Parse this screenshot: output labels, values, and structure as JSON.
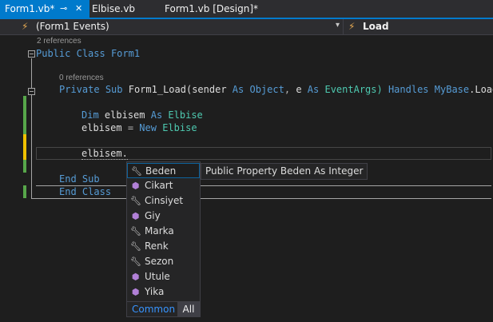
{
  "tabs": [
    {
      "label": "Form1.vb*",
      "active": true
    },
    {
      "label": "Elbise.vb",
      "active": false
    },
    {
      "label": "Form1.vb [Design]*",
      "active": false
    }
  ],
  "tab_icons": {
    "pin": "⊸",
    "close": "✕"
  },
  "nav": {
    "left": "(Form1 Events)",
    "right": "Load",
    "icon": "lightning-icon"
  },
  "code": {
    "lens_class": "2 references",
    "lens_sub": "0 references",
    "line_class": {
      "kw1": "Public",
      "kw2": "Class",
      "name": "Form1"
    },
    "line_sub": {
      "kw1": "Private",
      "kw2": "Sub",
      "name": "Form1_Load(sender",
      "as1": "As",
      "type1": "Object",
      "sep": ",",
      "param2": "e",
      "as2": "As",
      "type2": "EventArgs)",
      "handles": "Handles",
      "mybase": "MyBase",
      "event": ".Load"
    },
    "line_dim": {
      "kw": "Dim",
      "name": "elbisem",
      "as": "As",
      "type": "Elbise"
    },
    "line_assign": {
      "name": "elbisem",
      "eq": "=",
      "kw": "New",
      "type": "Elbise"
    },
    "line_typing": "elbisem.",
    "line_endsub": {
      "kw1": "End",
      "kw2": "Sub"
    },
    "line_endclass": {
      "kw1": "End",
      "kw2": "Class"
    }
  },
  "completion": {
    "items": [
      {
        "label": "Beden",
        "kind": "property",
        "icon": "wrench-icon",
        "selected": true
      },
      {
        "label": "Cikart",
        "kind": "method",
        "icon": "cube-icon",
        "selected": false
      },
      {
        "label": "Cinsiyet",
        "kind": "property",
        "icon": "wrench-icon",
        "selected": false
      },
      {
        "label": "Giy",
        "kind": "method",
        "icon": "cube-icon",
        "selected": false
      },
      {
        "label": "Marka",
        "kind": "property",
        "icon": "wrench-icon",
        "selected": false
      },
      {
        "label": "Renk",
        "kind": "property",
        "icon": "wrench-icon",
        "selected": false
      },
      {
        "label": "Sezon",
        "kind": "property",
        "icon": "wrench-icon",
        "selected": false
      },
      {
        "label": "Utule",
        "kind": "method",
        "icon": "cube-icon",
        "selected": false
      },
      {
        "label": "Yika",
        "kind": "method",
        "icon": "cube-icon",
        "selected": false
      }
    ],
    "filters": {
      "common": "Common",
      "all": "All"
    },
    "tooltip": "Public Property Beden As Integer"
  },
  "colors": {
    "accent": "#007acc",
    "keyword": "#569cd6",
    "type": "#4ec9b0",
    "change_saved": "#57a64a",
    "change_unsaved": "#efc000"
  }
}
